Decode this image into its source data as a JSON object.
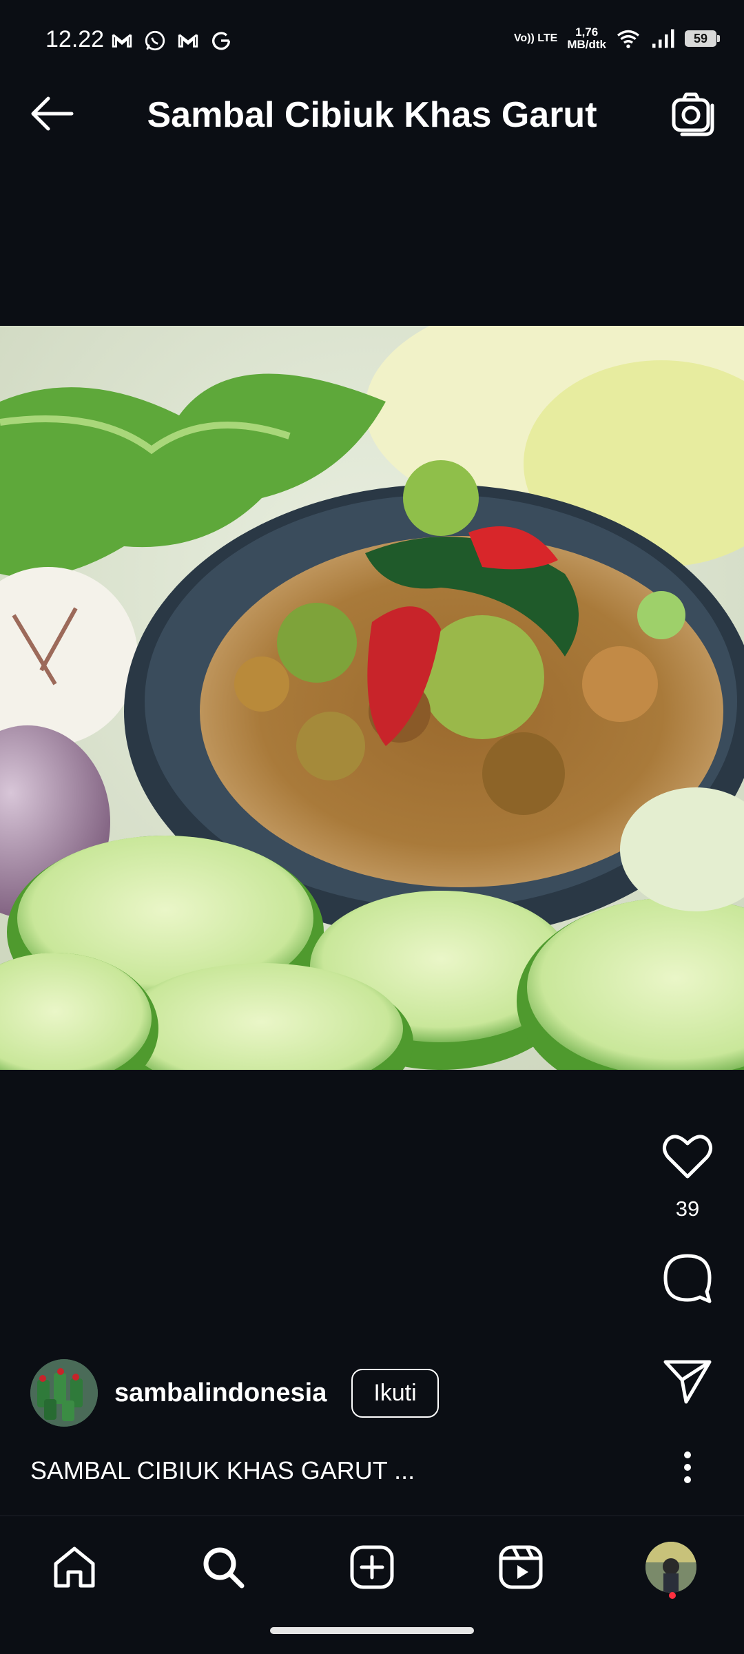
{
  "status_bar": {
    "time": "12.22",
    "notification_icons": [
      "gmail-icon",
      "whatsapp-icon",
      "gmail-icon",
      "google-icon"
    ],
    "network_type": "Vo)) LTE",
    "network_speed_value": "1,76",
    "network_speed_unit": "MB/dtk",
    "battery": "59"
  },
  "top_bar": {
    "title": "Sambal Cibiuk Khas Garut",
    "back_icon": "arrow-left-icon",
    "camera_icon": "camera-icon"
  },
  "post": {
    "like_count": "39",
    "author": {
      "username": "sambalindonesia",
      "follow_label": "Ikuti"
    },
    "caption": "SAMBAL CIBIUK KHAS GARUT ..."
  },
  "bottom_nav": {
    "items": [
      "home-icon",
      "search-icon",
      "create-icon",
      "reels-icon",
      "profile-avatar"
    ],
    "active": "search"
  },
  "colors": {
    "background": "#0b0e14",
    "text": "#ffffff",
    "notification_dot": "#ff3040"
  }
}
